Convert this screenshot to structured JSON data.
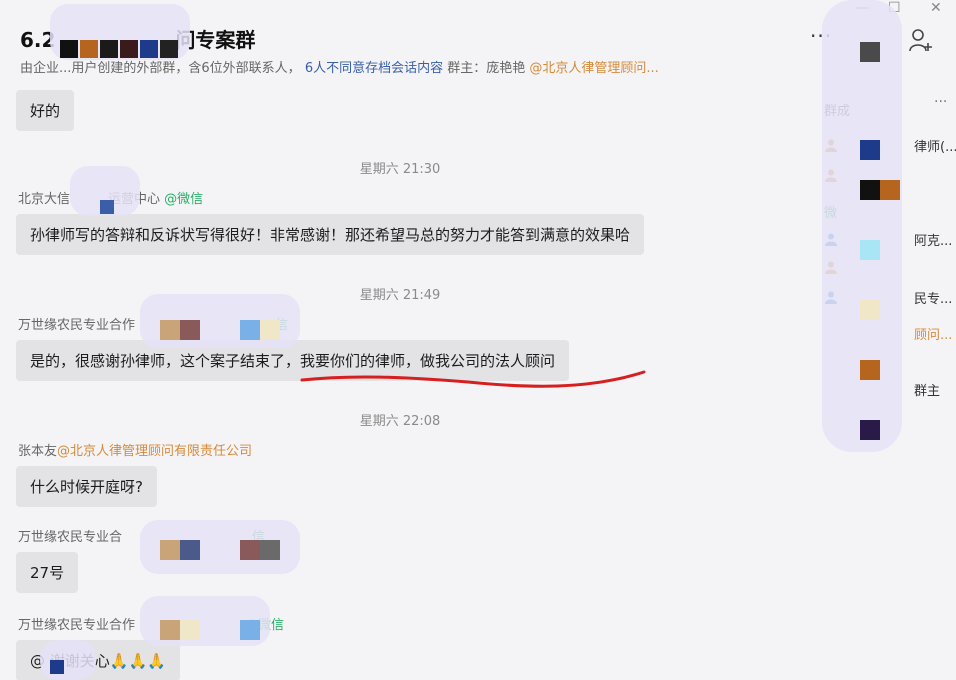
{
  "header": {
    "title_prefix": "6.2",
    "title_suffix": "问专案群",
    "more_label": "···",
    "subtitle_main": "由企业...用户创建的外部群，含6位外部联系人，",
    "subtitle_link": "6人不同意存档会话内容",
    "subtitle_owner": "群主：庞艳艳",
    "subtitle_org": "@北京人律管理顾问..."
  },
  "window_controls": {
    "minimize": "—",
    "maximize": "☐",
    "close": "✕"
  },
  "messages": [
    {
      "type": "bubble",
      "text": "好的"
    },
    {
      "type": "time",
      "text": "星期六 21:30"
    },
    {
      "type": "sender",
      "name": "北京大信",
      "name2": "运营中心",
      "source": "@微信"
    },
    {
      "type": "bubble",
      "text": "孙律师写的答辩和反诉状写得很好！非常感谢！那还希望马总的努力才能答到满意的效果哈"
    },
    {
      "type": "time",
      "text": "星期六 21:49"
    },
    {
      "type": "sender",
      "name": "万世缘农民专业合作",
      "source": "信"
    },
    {
      "type": "bubble",
      "text": "是的，很感谢孙律师，这个案子结束了，我要你们的律师，做我公司的法人顾问"
    },
    {
      "type": "time",
      "text": "星期六 22:08"
    },
    {
      "type": "sender",
      "name": "张本友",
      "source": "@北京人律管理顾问有限责任公司"
    },
    {
      "type": "bubble",
      "text": "什么时候开庭呀?"
    },
    {
      "type": "sender",
      "name": "万世缘农民专业合",
      "source": "信"
    },
    {
      "type": "bubble",
      "text": "27号"
    },
    {
      "type": "sender",
      "name": "万世缘农民专业合作",
      "source": "@微信"
    },
    {
      "type": "bubble",
      "text": "@   谢谢关心🙏🙏🙏"
    }
  ],
  "sidebar": {
    "title": "群成",
    "more": "···",
    "members": [
      {
        "name": "律师(...",
        "kind": "plain"
      },
      {
        "name": "",
        "kind": "plain"
      },
      {
        "name": "微",
        "kind": "wechat"
      },
      {
        "name": "阿克...",
        "kind": "plain"
      },
      {
        "name": "",
        "kind": "plain"
      },
      {
        "name": "民专...",
        "kind": "plain"
      },
      {
        "name": "顾问...",
        "kind": "org"
      },
      {
        "name": "群主",
        "kind": "plain"
      }
    ]
  },
  "colors": {
    "background": "#f4f4f6",
    "bubble": "#e3e3e6",
    "wechat_green": "#2aae67",
    "org_orange": "#d68a3a",
    "link_blue": "#3a5fa8",
    "annotation_red": "#d62020"
  },
  "icons": [
    "add-member-icon",
    "more-icon",
    "member-avatar-icon"
  ]
}
